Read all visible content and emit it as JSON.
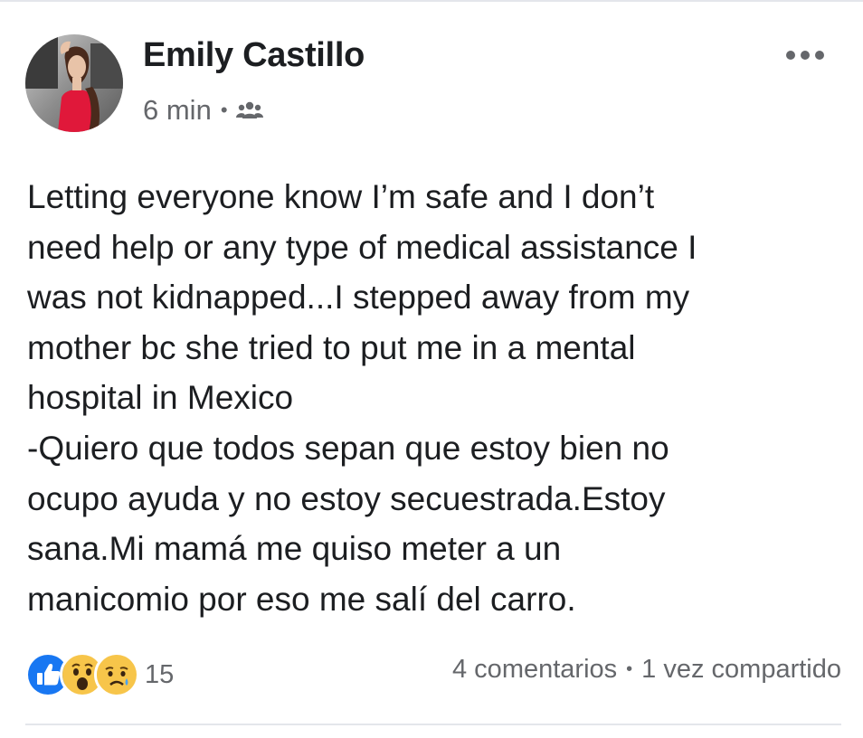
{
  "post": {
    "author": "Emily Castillo",
    "time": "6 min",
    "separator": "•",
    "audience_icon": "friends-icon",
    "more_icon": "more-options-icon",
    "text_lines": [
      "Letting everyone know I’m safe and I don’t",
      "need help or any type of medical assistance I",
      "was not kidnapped...I stepped away from my",
      "mother bc she tried to put me in a mental",
      "hospital in Mexico",
      "-Quiero que todos sepan que estoy bien no",
      "ocupo ayuda y no estoy secuestrada.Estoy",
      "sana.Mi mamá me quiso meter a un",
      "manicomio por eso me salí del carro."
    ]
  },
  "footer": {
    "reaction_icons": [
      "like-icon",
      "wow-icon",
      "sad-icon"
    ],
    "reaction_count": "15",
    "comments": "4 comentarios",
    "separator": "•",
    "shares": "1 vez compartido"
  },
  "colors": {
    "text": "#1c1e21",
    "secondary": "#65676b",
    "like_blue": "#1877f2",
    "reaction_yellow": "#f7c54a",
    "divider": "#e4e6eb"
  }
}
